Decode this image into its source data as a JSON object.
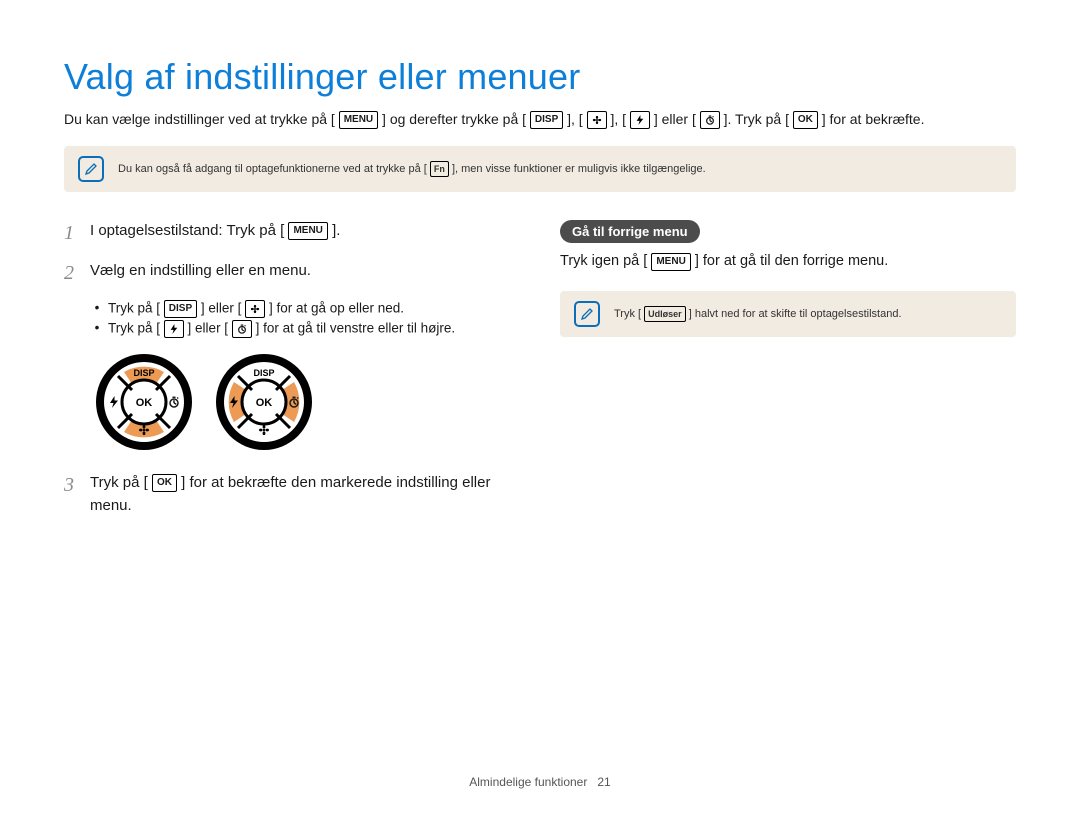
{
  "title": "Valg af indstillinger eller menuer",
  "intro": {
    "t1": "Du kan vælge indstillinger ved at trykke på [",
    "k1": "MENU",
    "t2": "] og derefter trykke på [",
    "k2": "DISP",
    "t3": "], [",
    "t4": "], [",
    "t5": "] eller [",
    "t6": "]. Tryk på [",
    "k6": "OK",
    "t7": "] for at bekræfte."
  },
  "note1": {
    "t1": "Du kan også få adgang til optagefunktionerne ved at trykke på [",
    "k1": "Fn",
    "t2": "], men visse funktioner er muligvis ikke tilgængelige."
  },
  "steps": {
    "s1": {
      "num": "1",
      "t1": "I optagelsestilstand: Tryk på [",
      "k1": "MENU",
      "t2": "]."
    },
    "s2": {
      "num": "2",
      "t1": "Vælg en indstilling eller en menu."
    },
    "sub1": {
      "t1": "Tryk på [",
      "k1": "DISP",
      "t2": "] eller [",
      "t3": "] for at gå op eller ned."
    },
    "sub2": {
      "t1": "Tryk på [",
      "t2": "] eller [",
      "t3": "] for at gå til venstre eller til højre."
    },
    "s3": {
      "num": "3",
      "t1": "Tryk på [",
      "k1": "OK",
      "t2": "] for at bekræfte den markerede indstilling eller menu."
    }
  },
  "dial": {
    "disp": "DISP",
    "ok": "OK"
  },
  "right": {
    "heading": "Gå til forrige menu",
    "t1": "Tryk igen på [",
    "k1": "MENU",
    "t2": "] for at gå til den forrige menu.",
    "note": {
      "t1": "Tryk [",
      "k1": "Udløser",
      "t2": "] halvt ned for at skifte til optagelsestilstand."
    }
  },
  "footer": {
    "section": "Almindelige funktioner",
    "page": "21"
  }
}
